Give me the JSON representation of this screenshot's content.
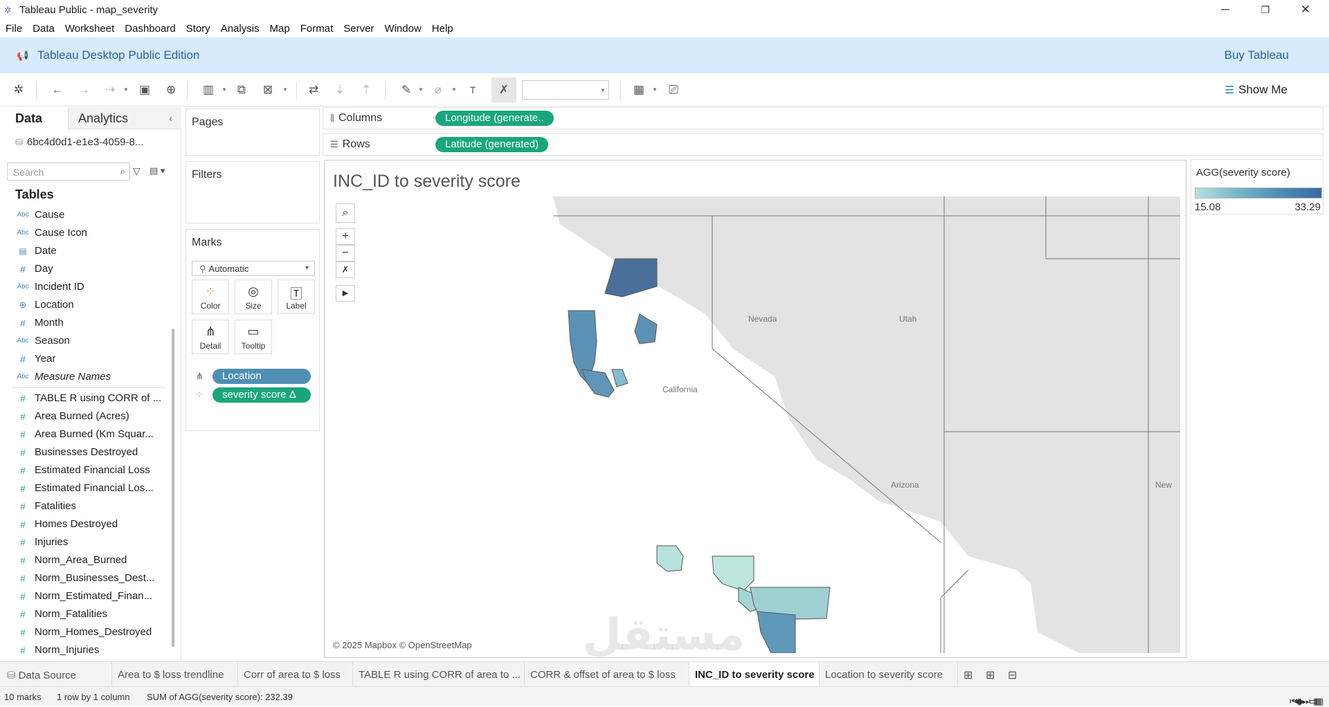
{
  "window": {
    "title": "Tableau Public - map_severity",
    "controls": {
      "minimize": "─",
      "restore": "❐",
      "close": "✕"
    }
  },
  "menu": [
    "File",
    "Data",
    "Worksheet",
    "Dashboard",
    "Story",
    "Analysis",
    "Map",
    "Format",
    "Server",
    "Window",
    "Help"
  ],
  "banner": {
    "edition": "Tableau Desktop Public Edition",
    "buy": "Buy Tableau"
  },
  "toolbar": {
    "show_me": "Show Me"
  },
  "datapane": {
    "tab_data": "Data",
    "tab_analytics": "Analytics",
    "datasource": "6bc4d0d1-e1e3-4059-8...",
    "search_placeholder": "Search",
    "tables_heading": "Tables",
    "dimensions": [
      {
        "type": "Abc",
        "name": "Cause"
      },
      {
        "type": "Abc",
        "name": "Cause Icon"
      },
      {
        "type": "date",
        "name": "Date"
      },
      {
        "type": "#",
        "name": "Day"
      },
      {
        "type": "Abc",
        "name": "Incident ID"
      },
      {
        "type": "geo",
        "name": "Location"
      },
      {
        "type": "#",
        "name": "Month"
      },
      {
        "type": "Abc",
        "name": "Season"
      },
      {
        "type": "#",
        "name": "Year"
      },
      {
        "type": "Abc",
        "name": "Measure Names"
      }
    ],
    "measures": [
      {
        "type": "#",
        "name": "TABLE R using CORR of ..."
      },
      {
        "type": "#",
        "name": "Area Burned (Acres)"
      },
      {
        "type": "#",
        "name": "Area Burned (Km Squar..."
      },
      {
        "type": "#",
        "name": "Businesses Destroyed"
      },
      {
        "type": "#",
        "name": "Estimated Financial Loss"
      },
      {
        "type": "#",
        "name": "Estimated Financial Los..."
      },
      {
        "type": "#",
        "name": "Fatalities"
      },
      {
        "type": "#",
        "name": "Homes Destroyed"
      },
      {
        "type": "#",
        "name": "Injuries"
      },
      {
        "type": "#",
        "name": "Norm_Area_Burned"
      },
      {
        "type": "#",
        "name": "Norm_Businesses_Dest..."
      },
      {
        "type": "#",
        "name": "Norm_Estimated_Finan..."
      },
      {
        "type": "#",
        "name": "Norm_Fatalities"
      },
      {
        "type": "#",
        "name": "Norm_Homes_Destroyed"
      },
      {
        "type": "#",
        "name": "Norm_Injuries"
      }
    ]
  },
  "cards": {
    "pages": "Pages",
    "filters": "Filters",
    "marks": "Marks",
    "marks_type": "Automatic",
    "buttons": {
      "color": "Color",
      "size": "Size",
      "label": "Label",
      "detail": "Detail",
      "tooltip": "Tooltip"
    },
    "pills": {
      "location": "Location",
      "severity": "severity score Δ"
    }
  },
  "shelves": {
    "columns_label": "Columns",
    "rows_label": "Rows",
    "columns_pill": "Longitude (generate..",
    "rows_pill": "Latitude (generated)"
  },
  "view": {
    "title": "INC_ID to severity score",
    "attribution": "© 2025 Mapbox © OpenStreetMap",
    "map_labels": {
      "nevada": "Nevada",
      "utah": "Utah",
      "california": "California",
      "arizona": "Arizona",
      "new": "New"
    }
  },
  "legend": {
    "title": "AGG(severity score)",
    "min": "15.08",
    "max": "33.29",
    "color_low": "#b7e0de",
    "color_high": "#3a6aa0"
  },
  "sheet_tabs": {
    "datasource": "Data Source",
    "sheets": [
      "Area to $ loss trendline",
      "Corr of area to $ loss",
      "TABLE R using CORR of area to ...",
      "CORR & offset of area to $ loss",
      "INC_ID to severity score",
      "Location to severity score"
    ],
    "active_index": 4
  },
  "status": {
    "marks": "10 marks",
    "dims": "1 row by 1 column",
    "sum": "SUM of AGG(severity score): 232.39"
  },
  "watermark": "مستقل"
}
